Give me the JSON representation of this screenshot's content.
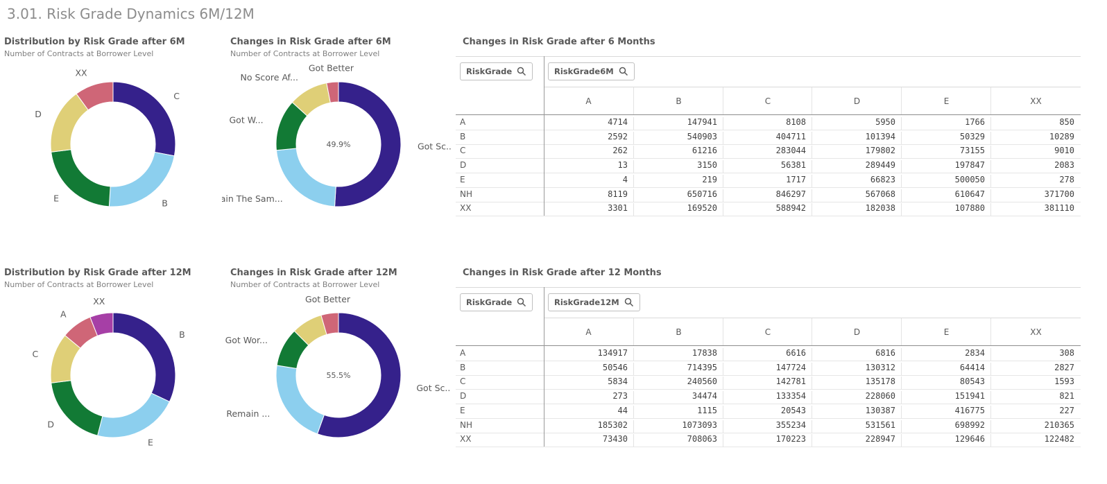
{
  "sheet_title": "3.01. Risk Grade Dynamics 6M/12M",
  "colors": {
    "dark_blue": "#35218b",
    "light_blue": "#8ccfee",
    "green": "#127a35",
    "khaki": "#dfcf77",
    "rose": "#cf6677",
    "magenta": "#a63fa6"
  },
  "charts_6m": {
    "dist": {
      "title": "Distribution by Risk Grade after 6M",
      "subtitle": "Number of Contracts at Borrower Level"
    },
    "changes": {
      "title": "Changes in Risk Grade after 6M",
      "subtitle": "Number of Contracts at Borrower Level",
      "center_value": "49.9%"
    }
  },
  "charts_12m": {
    "dist": {
      "title": "Distribution by Risk Grade after 12M",
      "subtitle": "Number of Contracts at Borrower Level"
    },
    "changes": {
      "title": "Changes in Risk Grade after 12M",
      "subtitle": "Number of Contracts at Borrower Level",
      "center_value": "55.5%"
    }
  },
  "chart_data": [
    {
      "type": "pie",
      "title": "Distribution by Risk Grade after 6M",
      "subtitle": "Number of Contracts at Borrower Level",
      "categories": [
        "C",
        "B",
        "E",
        "D",
        "XX"
      ],
      "values": [
        28,
        23,
        22,
        17,
        10
      ],
      "colors": [
        "#35218b",
        "#8ccfee",
        "#127a35",
        "#dfcf77",
        "#cf6677"
      ]
    },
    {
      "type": "pie",
      "title": "Changes in Risk Grade after 6M",
      "subtitle": "Number of Contracts at Borrower Level",
      "categories": [
        "Got Sc...",
        "Remain The Sam...",
        "Got W...",
        "No Score Af...",
        "Got Better"
      ],
      "values": [
        49.9,
        22,
        13,
        10,
        3
      ],
      "colors": [
        "#35218b",
        "#8ccfee",
        "#127a35",
        "#dfcf77",
        "#cf6677"
      ]
    },
    {
      "type": "pie",
      "title": "Distribution by Risk Grade after 12M",
      "subtitle": "Number of Contracts at Borrower Level",
      "categories": [
        "B",
        "E",
        "D",
        "C",
        "A",
        "XX"
      ],
      "values": [
        32,
        22,
        19,
        13,
        8,
        6
      ],
      "colors": [
        "#35218b",
        "#8ccfee",
        "#127a35",
        "#dfcf77",
        "#cf6677",
        "#a63fa6"
      ]
    },
    {
      "type": "pie",
      "title": "Changes in Risk Grade after 12M",
      "subtitle": "Number of Contracts at Borrower Level",
      "categories": [
        "Got Sc...",
        "Remain ...",
        "Got Wor...",
        "",
        "Got Better"
      ],
      "values": [
        55.5,
        22,
        10,
        8,
        4.5
      ],
      "colors": [
        "#35218b",
        "#8ccfee",
        "#127a35",
        "#dfcf77",
        "#cf6677"
      ]
    }
  ],
  "table_6m": {
    "title": "Changes in Risk Grade after 6 Months",
    "row_dim": "RiskGrade",
    "col_dim": "RiskGrade6M",
    "columns": [
      "A",
      "B",
      "C",
      "D",
      "E",
      "XX"
    ],
    "rows": [
      {
        "label": "A",
        "cells": [
          "4714",
          "147941",
          "8108",
          "5950",
          "1766",
          "850"
        ]
      },
      {
        "label": "B",
        "cells": [
          "2592",
          "540903",
          "404711",
          "101394",
          "50329",
          "10289"
        ]
      },
      {
        "label": "C",
        "cells": [
          "262",
          "61216",
          "283044",
          "179802",
          "73155",
          "9010"
        ]
      },
      {
        "label": "D",
        "cells": [
          "13",
          "3150",
          "56381",
          "289449",
          "197847",
          "2083"
        ]
      },
      {
        "label": "E",
        "cells": [
          "4",
          "219",
          "1717",
          "66823",
          "500050",
          "278"
        ]
      },
      {
        "label": "NH",
        "cells": [
          "8119",
          "650716",
          "846297",
          "567068",
          "610647",
          "371700"
        ]
      },
      {
        "label": "XX",
        "cells": [
          "3301",
          "169520",
          "588942",
          "182038",
          "107880",
          "381110"
        ]
      }
    ]
  },
  "table_12m": {
    "title": "Changes in Risk Grade after 12 Months",
    "row_dim": "RiskGrade",
    "col_dim": "RiskGrade12M",
    "columns": [
      "A",
      "B",
      "C",
      "D",
      "E",
      "XX"
    ],
    "rows": [
      {
        "label": "A",
        "cells": [
          "134917",
          "17838",
          "6616",
          "6816",
          "2834",
          "308"
        ]
      },
      {
        "label": "B",
        "cells": [
          "50546",
          "714395",
          "147724",
          "130312",
          "64414",
          "2827"
        ]
      },
      {
        "label": "C",
        "cells": [
          "5834",
          "240560",
          "142781",
          "135178",
          "80543",
          "1593"
        ]
      },
      {
        "label": "D",
        "cells": [
          "273",
          "34474",
          "133354",
          "228060",
          "151941",
          "821"
        ]
      },
      {
        "label": "E",
        "cells": [
          "44",
          "1115",
          "20543",
          "130387",
          "416775",
          "227"
        ]
      },
      {
        "label": "NH",
        "cells": [
          "185302",
          "1073093",
          "355234",
          "531561",
          "698992",
          "210365"
        ]
      },
      {
        "label": "XX",
        "cells": [
          "73430",
          "708063",
          "170223",
          "228947",
          "129646",
          "122482"
        ]
      }
    ]
  }
}
